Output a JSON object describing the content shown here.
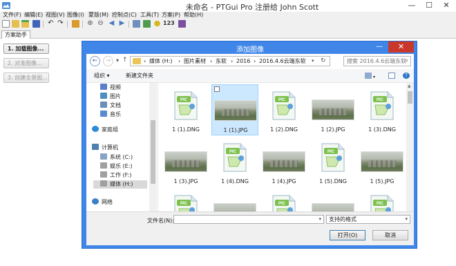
{
  "window": {
    "title": "未命名 - PTGui Pro 注册给 John Scott",
    "minimize_glyph": "—",
    "maximize_glyph": "☐",
    "close_glyph": "✕"
  },
  "menu": [
    "文件(F)",
    "编辑(E)",
    "视图(V)",
    "图像(I)",
    "蒙版(M)",
    "控制点(C)",
    "工具(T)",
    "方案(P)",
    "帮助(H)"
  ],
  "toolbar": {
    "zoom_text": "123"
  },
  "tab": {
    "label": "方案助手"
  },
  "steps": [
    {
      "label": "1. 加载图像...",
      "enabled": true
    },
    {
      "label": "2. 对准图像...",
      "enabled": false
    },
    {
      "label": "3. 创建全景图...",
      "enabled": false
    }
  ],
  "dialog": {
    "title": "添加图像",
    "close_glyph": "✕",
    "min_glyph": "—",
    "address": {
      "separator": "›",
      "segments": [
        "媒体 (H:)",
        "图片素材",
        "东软",
        "2016",
        "2016.4.6云端东软"
      ]
    },
    "search_placeholder": "搜索 2016.4.6云端东软",
    "commands": {
      "organize": "组织 ▾",
      "new_folder": "新建文件夹"
    },
    "nav": [
      {
        "label": "视频",
        "color": "#5b7fc9",
        "sub": true
      },
      {
        "label": "图片",
        "color": "#4f8fc0",
        "sub": true
      },
      {
        "label": "文档",
        "color": "#6a8fb8",
        "sub": true
      },
      {
        "label": "音乐",
        "color": "#5a8ad0",
        "sub": true
      },
      {
        "label": "家庭组",
        "color": "#2d8ad6",
        "sub": false
      },
      {
        "label": "计算机",
        "color": "#4f7fb3",
        "sub": false
      },
      {
        "label": "系统 (C:)",
        "color": "#8aa3c2",
        "sub": true
      },
      {
        "label": "娱乐 (E:)",
        "color": "#a0a0a0",
        "sub": true
      },
      {
        "label": "工作 (F:)",
        "color": "#a0a0a0",
        "sub": true
      },
      {
        "label": "媒体 (H:)",
        "color": "#a0a0a0",
        "sub": true,
        "selected": true
      },
      {
        "label": "网络",
        "color": "#3a7fc9",
        "sub": false
      }
    ],
    "files": [
      {
        "name": "1 (1).DNG",
        "kind": "pic"
      },
      {
        "name": "1 (1).JPG",
        "kind": "photo",
        "selected": true
      },
      {
        "name": "1 (2).DNG",
        "kind": "pic"
      },
      {
        "name": "1 (2).JPG",
        "kind": "photo"
      },
      {
        "name": "1 (3).DNG",
        "kind": "pic"
      },
      {
        "name": "1 (3).JPG",
        "kind": "photo"
      },
      {
        "name": "1 (4).DNG",
        "kind": "pic"
      },
      {
        "name": "1 (4).JPG",
        "kind": "photo"
      },
      {
        "name": "1 (5).DNG",
        "kind": "pic"
      },
      {
        "name": "1 (5).JPG",
        "kind": "photo"
      },
      {
        "name": "",
        "kind": "pic"
      },
      {
        "name": "",
        "kind": "photo"
      },
      {
        "name": "",
        "kind": "pic"
      },
      {
        "name": "",
        "kind": "photo"
      },
      {
        "name": "",
        "kind": "pic"
      }
    ],
    "filename_label": "文件名(N):",
    "filename_value": "",
    "filetype": "支持的格式",
    "open_label": "打开(O)",
    "cancel_label": "取消"
  }
}
